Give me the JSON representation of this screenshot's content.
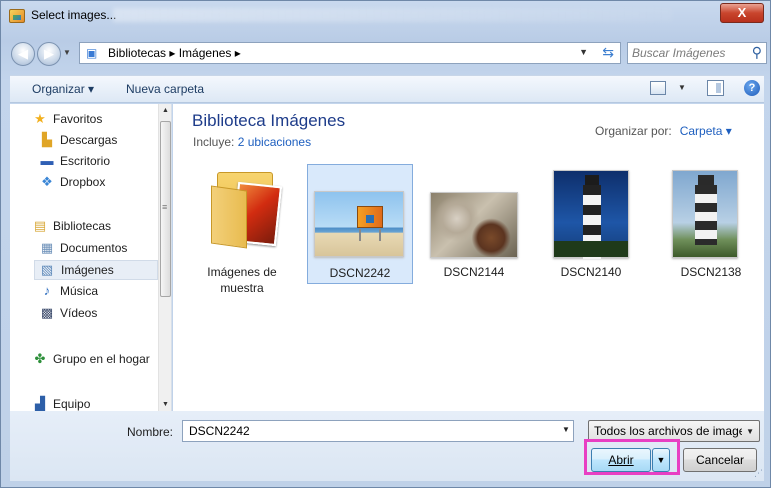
{
  "window": {
    "title": "Select images...",
    "close_label": "X"
  },
  "navigation": {
    "address_path": "Bibliotecas ▸ Imágenes ▸",
    "search_placeholder": "Buscar Imágenes"
  },
  "command_bar": {
    "organize_label": "Organizar ▾",
    "new_folder_label": "Nueva carpeta",
    "help_label": "?"
  },
  "sidebar": {
    "items": [
      {
        "label": "Favoritos",
        "icon": "star-icon"
      },
      {
        "label": "Descargas",
        "icon": "downloads-icon"
      },
      {
        "label": "Escritorio",
        "icon": "desktop-icon"
      },
      {
        "label": "Dropbox",
        "icon": "dropbox-icon"
      },
      {
        "label": "Bibliotecas",
        "icon": "libraries-icon"
      },
      {
        "label": "Documentos",
        "icon": "documents-icon"
      },
      {
        "label": "Imágenes",
        "icon": "pictures-icon",
        "selected": true
      },
      {
        "label": "Música",
        "icon": "music-icon"
      },
      {
        "label": "Vídeos",
        "icon": "videos-icon"
      },
      {
        "label": "Grupo en el hogar",
        "icon": "homegroup-icon"
      },
      {
        "label": "Equipo",
        "icon": "computer-icon"
      }
    ]
  },
  "library": {
    "title": "Biblioteca Imágenes",
    "includes_label": "Incluye:",
    "includes_link": "2 ubicaciones",
    "arrange_label": "Organizar por:",
    "arrange_value": "Carpeta ▾"
  },
  "files": [
    {
      "name": "Imágenes de muestra",
      "type": "folder"
    },
    {
      "name": "DSCN2242",
      "type": "image",
      "selected": true
    },
    {
      "name": "DSCN2144",
      "type": "image"
    },
    {
      "name": "DSCN2140",
      "type": "image"
    },
    {
      "name": "DSCN2138",
      "type": "image"
    }
  ],
  "footer": {
    "filename_label": "Nombre:",
    "filename_value": "DSCN2242",
    "filter_value": "Todos los archivos de imagen",
    "open_label": "Abrir",
    "cancel_label": "Cancelar"
  },
  "colors": {
    "highlight": "#e83fc3",
    "selection": "#d9e9fb",
    "link": "#1e5fbf"
  }
}
